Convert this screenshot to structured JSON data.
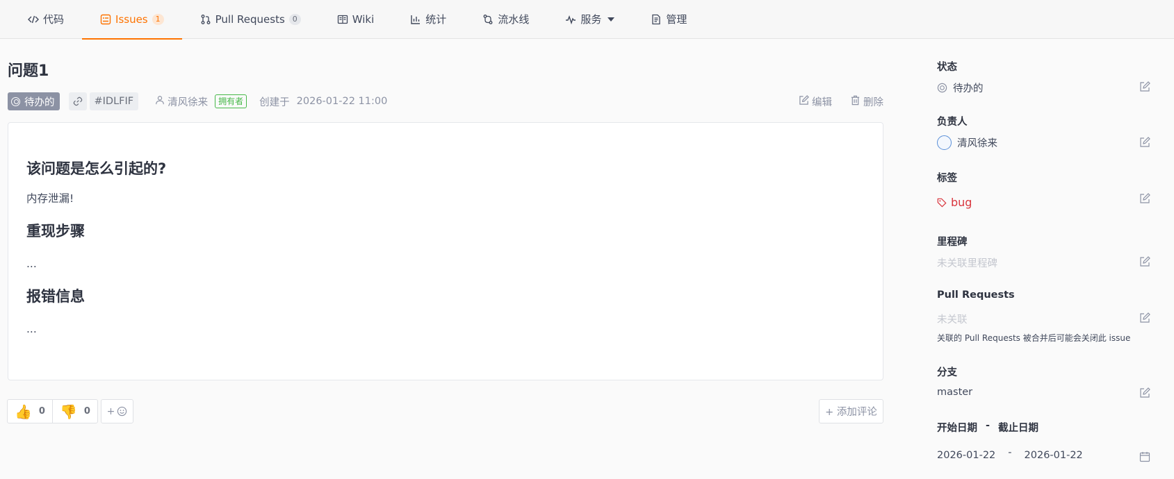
{
  "nav": {
    "tabs": [
      {
        "label": "代码",
        "icon": "code-icon"
      },
      {
        "label": "Issues",
        "icon": "issues-icon",
        "count": "1",
        "active": true
      },
      {
        "label": "Pull Requests",
        "icon": "pull-request-icon",
        "count": "0"
      },
      {
        "label": "Wiki",
        "icon": "wiki-icon"
      },
      {
        "label": "统计",
        "icon": "stats-icon"
      },
      {
        "label": "流水线",
        "icon": "pipeline-icon"
      },
      {
        "label": "服务",
        "icon": "service-icon"
      },
      {
        "label": "管理",
        "icon": "manage-icon"
      }
    ]
  },
  "issue": {
    "title": "问题1",
    "state": "待办的",
    "id": "#IDLFIF",
    "author": "清风徐来",
    "author_role": "拥有者",
    "created_label": "创建于",
    "created_time": "2026-01-22 11:00",
    "edit_label": "编辑",
    "delete_label": "删除"
  },
  "body": {
    "h1": "该问题是怎么引起的?",
    "p1": "内存泄漏!",
    "h2": "重现步骤",
    "p2": "...",
    "h3": "报错信息",
    "p3": "..."
  },
  "reactions": {
    "thumbs_up": "0",
    "thumbs_down": "0",
    "add_emoji": "+",
    "add_comment": "+ 添加评论"
  },
  "sidebar": {
    "status_h": "状态",
    "status_v": "待办的",
    "assignee_h": "负责人",
    "assignee_v": "清风徐来",
    "labels_h": "标签",
    "labels_v": "bug",
    "milestone_h": "里程碑",
    "milestone_v": "未关联里程碑",
    "pr_h": "Pull Requests",
    "pr_v": "未关联",
    "pr_note": "关联的 Pull Requests 被合并后可能会关闭此 issue",
    "branch_h": "分支",
    "branch_v": "master",
    "dates_h_start": "开始日期",
    "dates_h_sep": "-",
    "dates_h_end": "截止日期",
    "date_start": "2026-01-22",
    "date_sep": "-",
    "date_end": "2026-01-22"
  },
  "colors": {
    "accent": "#fe7300",
    "owner_green": "#46b848",
    "bug_red": "#d9363e",
    "state_gray": "#8c92a4"
  }
}
